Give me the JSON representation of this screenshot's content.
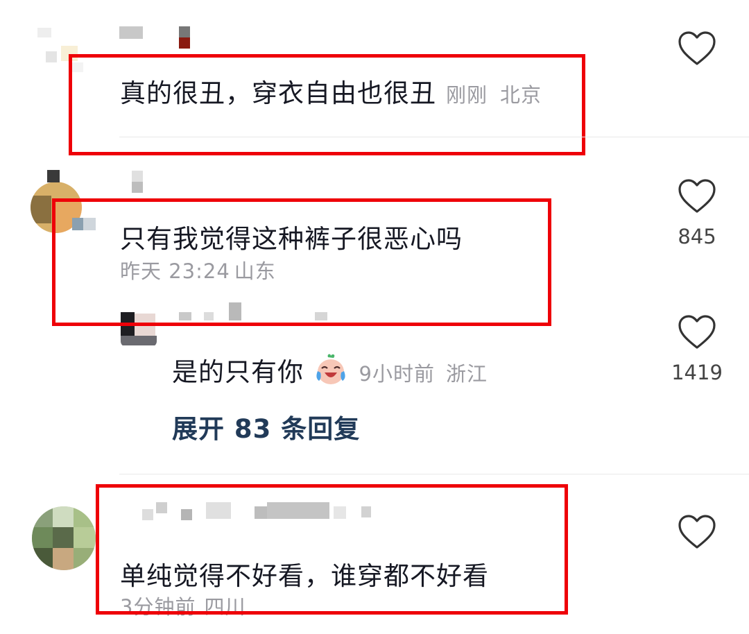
{
  "comments": [
    {
      "text": "真的很丑，穿衣自由也很丑",
      "time": "刚刚",
      "location": "北京",
      "likes": ""
    },
    {
      "text": "只有我觉得这种裤子很恶心吗",
      "time": "昨天 23:24",
      "location": "山东",
      "likes": "845",
      "reply": {
        "text": "是的只有你",
        "emoji": "crying-laughing-emoji",
        "time": "9小时前",
        "location": "浙江",
        "likes": "1419"
      },
      "expand_label": "展开 83 条回复"
    },
    {
      "text": "单纯觉得不好看，谁穿都不好看",
      "time": "3分钟前",
      "location": "四川",
      "likes": ""
    }
  ],
  "colors": {
    "highlight_box": "#ee0008",
    "expand_link": "#213a58",
    "meta_text": "#9a9aa0"
  },
  "icons": [
    "heart-icon",
    "avatar"
  ]
}
